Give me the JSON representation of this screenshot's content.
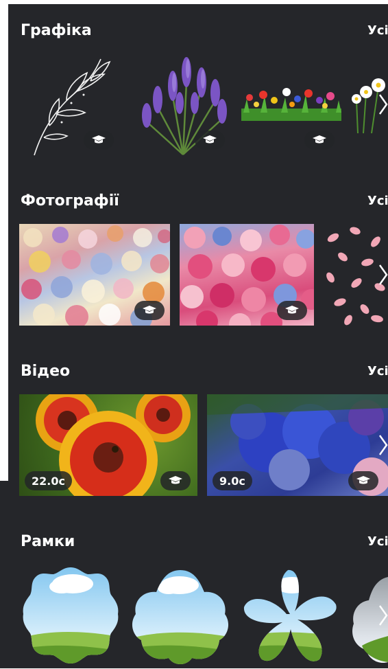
{
  "sections": {
    "graphics": {
      "title": "Графіка",
      "see_all": "Усі"
    },
    "photos": {
      "title": "Фотографії",
      "see_all": "Усі"
    },
    "videos": {
      "title": "Відео",
      "see_all": "Усі",
      "durations": [
        "22.0с",
        "9.0с"
      ]
    },
    "frames": {
      "title": "Рамки",
      "see_all": "Усі"
    }
  },
  "icons": {
    "premium": "graduation-cap-icon",
    "next": "chevron-right-icon"
  },
  "colors": {
    "panel_bg": "#25262a",
    "badge_bg": "#232628",
    "text": "#ffffff"
  }
}
